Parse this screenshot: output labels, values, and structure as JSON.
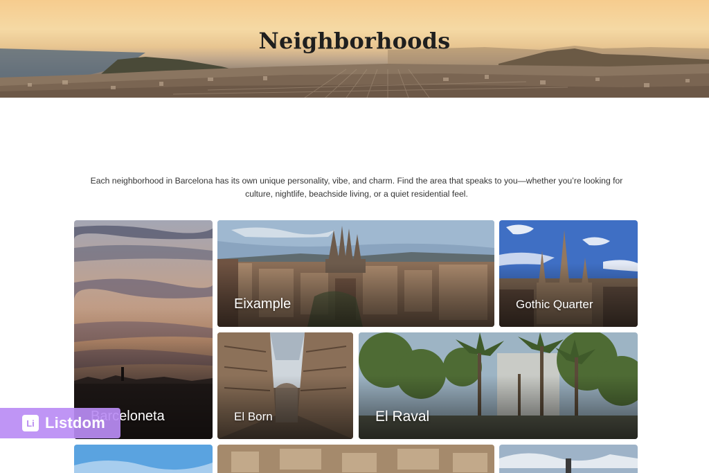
{
  "hero": {
    "title": "Neighborhoods"
  },
  "intro": {
    "text": "Each neighborhood in Barcelona has its own unique personality, vibe, and charm. Find the area that speaks to you—whether you’re looking for culture, nightlife, beachside living, or a quiet residential feel."
  },
  "cards": [
    {
      "label": "Barceloneta"
    },
    {
      "label": "Eixample"
    },
    {
      "label": "Gothic Quarter"
    },
    {
      "label": "El Born"
    },
    {
      "label": "El Raval"
    }
  ],
  "badge": {
    "logo_text": "Li",
    "text": "Listdom",
    "color": "#ba8cf4"
  }
}
